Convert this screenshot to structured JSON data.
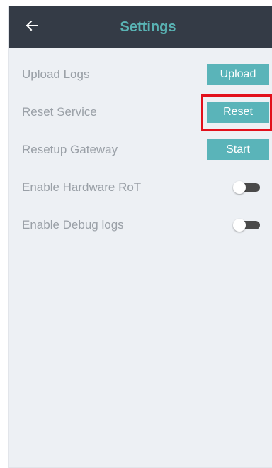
{
  "header": {
    "title": "Settings",
    "back_icon": "arrow-left-icon"
  },
  "settings": {
    "upload_logs": {
      "label": "Upload Logs",
      "button": "Upload"
    },
    "reset_service": {
      "label": "Reset Service",
      "button": "Reset"
    },
    "resetup_gateway": {
      "label": "Resetup Gateway",
      "button": "Start"
    },
    "enable_hardware_rot": {
      "label": "Enable Hardware RoT",
      "enabled": false
    },
    "enable_debug_logs": {
      "label": "Enable Debug logs",
      "enabled": false
    }
  },
  "colors": {
    "header_bg": "#343b46",
    "accent": "#59b3b4",
    "highlight": "#e2101c",
    "background": "#edf0f4"
  }
}
